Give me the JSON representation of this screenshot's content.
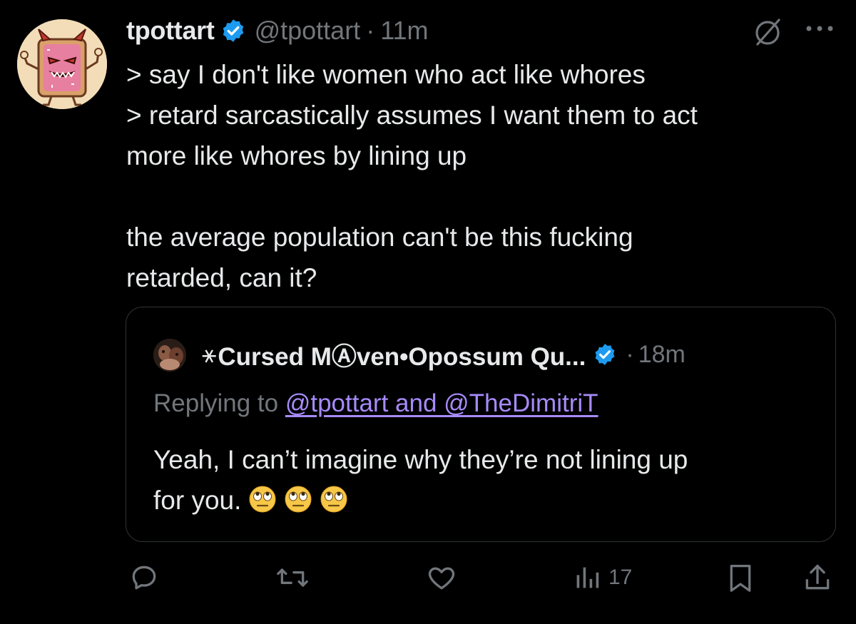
{
  "tweet": {
    "display_name": "tpottart",
    "handle": "@tpottart",
    "separator": "·",
    "time": "11m",
    "lines": [
      "> say I don't like women who act like whores",
      "> retard sarcastically assumes I want them to act",
      "more like whores by lining up",
      "the average population can't be this fucking",
      "retarded, can it?"
    ]
  },
  "quote": {
    "star": "⚹",
    "display_name": "Cursed MⒶven•Opossum Qu...",
    "separator": "·",
    "time": "18m",
    "replying_prefix": "Replying to ",
    "replying_mentions": "@tpottart and @TheDimitriT",
    "lines": [
      "Yeah, I can’t imagine why they’re not lining up",
      "for you."
    ],
    "emoji_count": 3
  },
  "actions": {
    "views_count": "17"
  },
  "colors": {
    "background": "#000000",
    "text": "#e7e9ea",
    "muted": "#71767b",
    "verified": "#1d9bf0",
    "mention_link": "#a78bfa",
    "border": "#2f3336"
  },
  "icons": [
    "grok-icon",
    "more-icon",
    "reply-icon",
    "repost-icon",
    "like-icon",
    "views-icon",
    "bookmark-icon",
    "share-icon",
    "verified-icon",
    "eye-roll-emoji"
  ]
}
